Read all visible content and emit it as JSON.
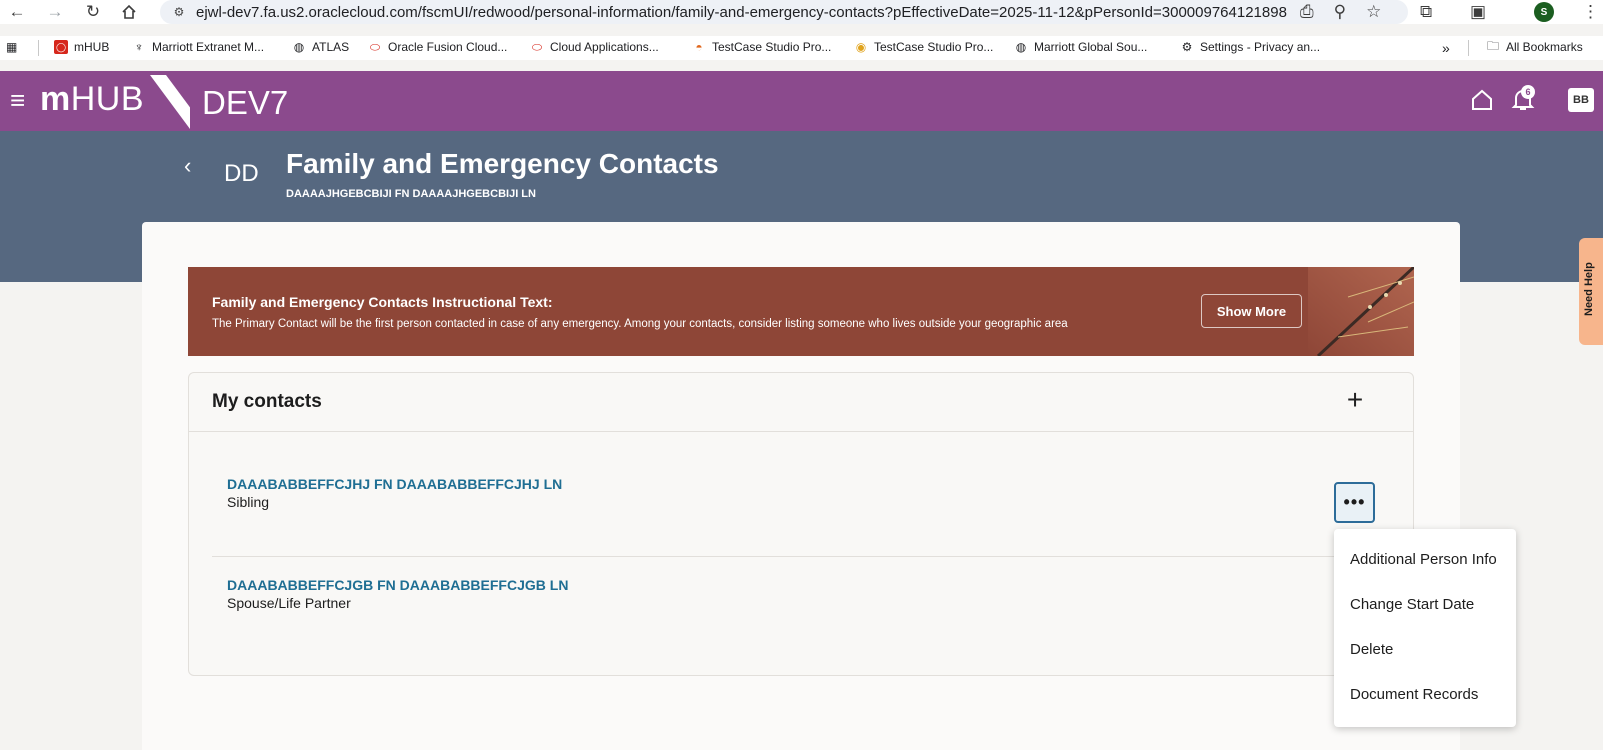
{
  "browser": {
    "url": "ejwl-dev7.fa.us2.oraclecloud.com/fscmUI/redwood/personal-information/family-and-emergency-contacts?pEffectiveDate=2025-11-12&pPersonId=300009764121898",
    "profile_initial": "S",
    "bookmarks": [
      {
        "label": "mHUB",
        "icon": "oracle-icon"
      },
      {
        "label": "Marriott Extranet M...",
        "icon": "marriott-icon"
      },
      {
        "label": "ATLAS",
        "icon": "globe-icon"
      },
      {
        "label": "Oracle Fusion Cloud...",
        "icon": "oracle-icon"
      },
      {
        "label": "Cloud Applications...",
        "icon": "oracle-icon"
      },
      {
        "label": "TestCase Studio Pro...",
        "icon": "testcase-icon"
      },
      {
        "label": "TestCase Studio Pro...",
        "icon": "testcase-icon"
      },
      {
        "label": "Marriott Global Sou...",
        "icon": "globe-icon"
      },
      {
        "label": "Settings - Privacy an...",
        "icon": "gear-icon"
      }
    ],
    "more_bookmarks": "»",
    "all_bookmarks": "All Bookmarks"
  },
  "app": {
    "logo_bold": "m",
    "logo_rest": "HUB",
    "environment": "DEV7",
    "notification_count": "6",
    "user_initials": "BB"
  },
  "page": {
    "initials": "DD",
    "title": "Family and Emergency Contacts",
    "subtitle": "DAAAAJHGEBCBIJI FN DAAAAJHGEBCBIJI LN"
  },
  "banner": {
    "title": "Family and Emergency Contacts Instructional Text:",
    "text": "The Primary Contact will be the first person contacted in case of any emergency. Among your contacts, consider listing someone who lives outside your geographic area",
    "show_more": "Show More"
  },
  "contacts": {
    "title": "My contacts",
    "add_label": "+",
    "items": [
      {
        "name": "DAAABABBEFFCJHJ FN DAAABABBEFFCJHJ LN",
        "relationship": "Sibling"
      },
      {
        "name": "DAAABABBEFFCJGB FN DAAABABBEFFCJGB LN",
        "relationship": "Spouse/Life Partner"
      }
    ]
  },
  "actions_menu": {
    "trigger": "•••",
    "items": [
      "Additional Person Info",
      "Change Start Date",
      "Delete",
      "Document Records"
    ]
  },
  "need_help": "Need Help",
  "colors": {
    "app_header": "#8b4a8d",
    "hero": "#566880",
    "banner": "#8e4637",
    "link": "#1f6e93",
    "need_help": "#f7b58c"
  }
}
